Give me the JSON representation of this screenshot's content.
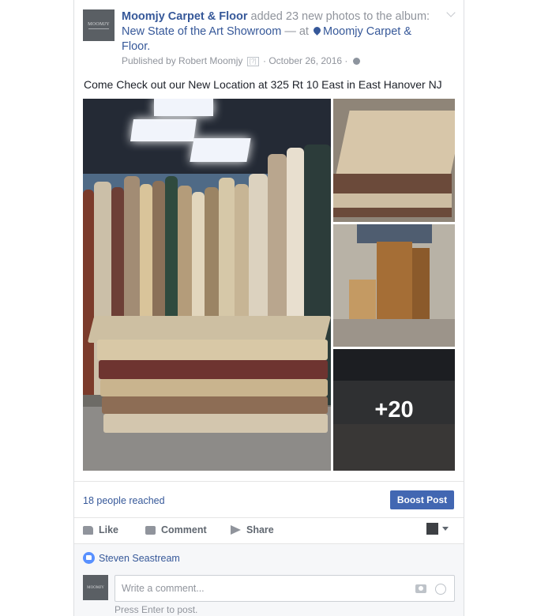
{
  "post": {
    "page_name": "Moomjy Carpet & Floor",
    "action_text": " added 23 new photos to the album: ",
    "album_name": "New State of the Art Showroom",
    "at_text": " — at ",
    "location": "Moomjy Carpet & Floor.",
    "published_by": "Published by Robert Moomjy",
    "help_mark": "[?]",
    "date": " · October 26, 2016 · ",
    "body_text": "Come Check out our New Location at 325 Rt 10 East in East Hanover NJ",
    "avatar_text": "MOOMJY",
    "more_photos": "+20"
  },
  "stats": {
    "reached": "18 people reached",
    "boost_label": "Boost Post"
  },
  "actions": {
    "like": "Like",
    "comment": "Comment",
    "share": "Share"
  },
  "comments": {
    "liker": "Steven Seastream",
    "placeholder": "Write a comment...",
    "hint": "Press Enter to post."
  },
  "icons": [
    "location-pin-icon",
    "globe-icon",
    "chevron-down-icon",
    "like-icon",
    "comment-icon",
    "share-icon",
    "camera-icon",
    "emoji-icon"
  ],
  "colors": {
    "link_blue": "#365899",
    "boost_blue": "#4267b2",
    "meta_gray": "#90949c",
    "like_badge": "#5890ff"
  }
}
